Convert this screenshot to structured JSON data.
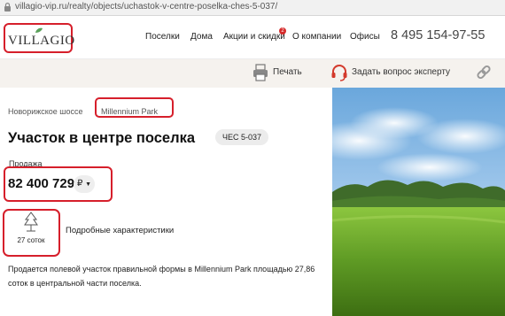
{
  "browser": {
    "url": "villagio-vip.ru/realty/objects/uchastok-v-centre-poselka-ches-5-037/"
  },
  "header": {
    "logo_text": "VILLAGIO",
    "nav": [
      {
        "label": "Поселки"
      },
      {
        "label": "Дома"
      },
      {
        "label": "Акции и скидки",
        "badge": "2"
      },
      {
        "label": "О компании"
      },
      {
        "label": "Офисы"
      }
    ],
    "phone": "8 495 154-97-55"
  },
  "toolbar": {
    "print_label": "Печать",
    "ask_label": "Задать вопрос эксперту"
  },
  "breadcrumb": {
    "items": [
      "Новорижское шоссе",
      "Millennium Park"
    ]
  },
  "listing": {
    "title": "Участок в центре поселка",
    "code": "ЧЕС 5-037",
    "price_label": "Продажа",
    "price": "82 400 729",
    "currency": "₽",
    "area": "27 соток",
    "details_link": "Подробные характеристики",
    "description": "Продается полевой участок правильной формы в Millennium Park площадью 27,86 соток в центральной части поселка."
  },
  "icons": [
    "lock-icon",
    "leaf-icon",
    "printer-icon",
    "headset-icon",
    "link-icon",
    "dropdown-triangle-icon",
    "tree-icon"
  ],
  "colors": {
    "highlight": "#d61f2b",
    "badge": "#d62b2b",
    "toolbar_bg": "#f5f2ee",
    "headset": "#d33a2c"
  }
}
